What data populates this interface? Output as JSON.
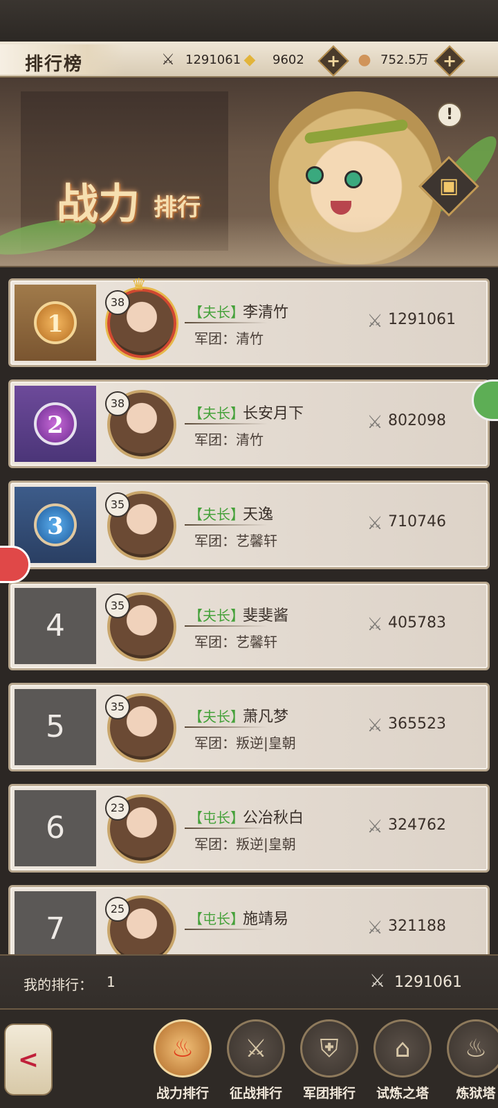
{
  "header": {
    "title": "排行榜",
    "resources": [
      {
        "icon": "crossed-swords-icon",
        "value": "1291061"
      },
      {
        "icon": "gold-ingot-icon",
        "value": "9602"
      },
      {
        "icon": "copper-coin-icon",
        "value": "752.5万"
      }
    ]
  },
  "banner": {
    "title_main": "战力",
    "title_sub": "排行"
  },
  "rankings": [
    {
      "rank": "1",
      "level": "38",
      "title": "【夫长】",
      "name": "李清竹",
      "legion": "军团：清竹",
      "power": "1291061",
      "medal": "gold"
    },
    {
      "rank": "2",
      "level": "38",
      "title": "【夫长】",
      "name": "长安月下",
      "legion": "军团：清竹",
      "power": "802098",
      "medal": "purple"
    },
    {
      "rank": "3",
      "level": "35",
      "title": "【夫长】",
      "name": "天逸",
      "legion": "军团：艺馨轩",
      "power": "710746",
      "medal": "blue"
    },
    {
      "rank": "4",
      "level": "35",
      "title": "【夫长】",
      "name": "斐斐酱",
      "legion": "军团：艺馨轩",
      "power": "405783"
    },
    {
      "rank": "5",
      "level": "35",
      "title": "【夫长】",
      "name": "萧凡梦",
      "legion": "军团：叛逆|皇朝",
      "power": "365523"
    },
    {
      "rank": "6",
      "level": "23",
      "title": "【屯长】",
      "name": "公冶秋白",
      "legion": "军团：叛逆|皇朝",
      "power": "324762"
    },
    {
      "rank": "7",
      "level": "25",
      "title": "【屯长】",
      "name": "施靖易",
      "legion": "",
      "power": "321188"
    }
  ],
  "my_rank": {
    "label": "我的排行：",
    "value": "1",
    "power": "1291061"
  },
  "nav": [
    {
      "label": "战力排行",
      "icon": "flame-icon",
      "active": true
    },
    {
      "label": "征战排行",
      "icon": "sword-icon",
      "active": false
    },
    {
      "label": "军团排行",
      "icon": "shield-icon",
      "active": false
    },
    {
      "label": "试炼之塔",
      "icon": "tower-icon",
      "active": false
    },
    {
      "label": "炼狱塔",
      "icon": "cauldron-icon",
      "active": false
    }
  ],
  "colors": {
    "title_green": "#45a13a",
    "accent_gold": "#c9a66b",
    "background": "#2f2a26"
  }
}
